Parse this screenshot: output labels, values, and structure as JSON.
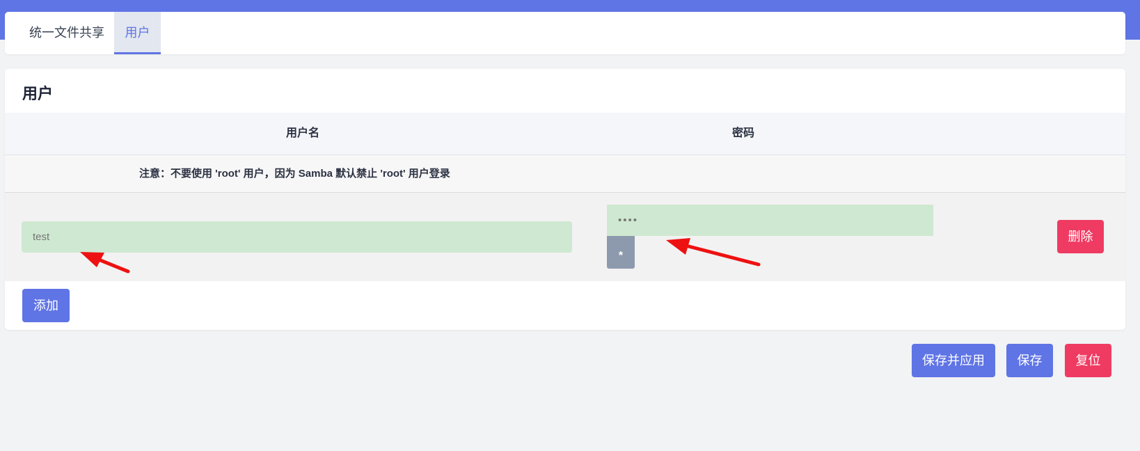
{
  "tabs": [
    {
      "label": "统一文件共享",
      "active": false
    },
    {
      "label": "用户",
      "active": true
    }
  ],
  "section": {
    "title": "用户",
    "columns": {
      "username": "用户名",
      "password": "密码"
    },
    "note": "注意：不要使用 'root' 用户，因为 Samba 默认禁止 'root' 用户登录",
    "rows": [
      {
        "username": "test",
        "password": "••••"
      }
    ],
    "reveal_label": "*",
    "delete_label": "删除",
    "add_label": "添加"
  },
  "footer": {
    "save_apply_label": "保存并应用",
    "save_label": "保存",
    "reset_label": "复位"
  },
  "colors": {
    "accent": "#5f74e5",
    "danger": "#ef3b62",
    "input_bg": "#cfe8d1",
    "annotation_arrow": "#ee1111"
  }
}
